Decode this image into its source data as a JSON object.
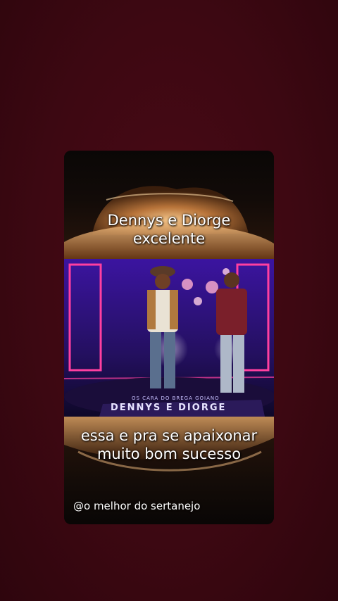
{
  "video_post": {
    "caption_top": [
      "Dennys e Diorge",
      "excelente"
    ],
    "caption_bottom": [
      "essa e pra se apaixonar",
      "muito bom sucesso"
    ],
    "author_handle": "@o melhor do sertanejo",
    "stage_banner": "OS CARA DO BREGA GOIANO",
    "stage_banner_big": "DENNYS E DIORGE"
  },
  "colors": {
    "background": "#3d0812",
    "stage_purple": "#5a22c8",
    "neon_pink": "#ff3fa0",
    "hat_gold": "#c98a4a"
  }
}
